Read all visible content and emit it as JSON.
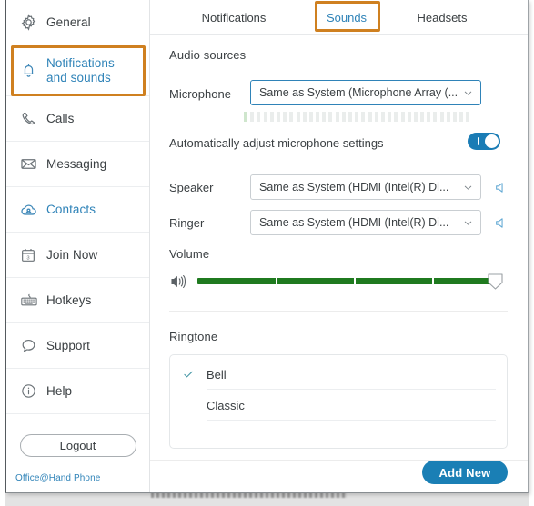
{
  "sidebar": {
    "items": [
      {
        "label": "General",
        "icon": "gear-icon",
        "accent": false
      },
      {
        "label": "Notifications and sounds",
        "label_line1": "Notifications",
        "label_line2": "and sounds",
        "icon": "bell-icon",
        "accent": true
      },
      {
        "label": "Calls",
        "icon": "phone-icon",
        "accent": false
      },
      {
        "label": "Messaging",
        "icon": "envelope-icon",
        "accent": false
      },
      {
        "label": "Contacts",
        "icon": "cloud-icon",
        "accent": true
      },
      {
        "label": "Join Now",
        "icon": "calendar-icon",
        "accent": false
      },
      {
        "label": "Hotkeys",
        "icon": "keyboard-icon",
        "accent": false
      },
      {
        "label": "Support",
        "icon": "chat-bubble-icon",
        "accent": false
      },
      {
        "label": "Help",
        "icon": "info-circle-icon",
        "accent": false
      }
    ],
    "logout_label": "Logout",
    "account_label": "Office@Hand Phone",
    "selected_item": "Notifications and sounds",
    "highlight_color": "#cf8020",
    "accent_color": "#2f83b8"
  },
  "tabs": {
    "items": [
      {
        "label": "Notifications",
        "active": false
      },
      {
        "label": "Sounds",
        "active": true
      },
      {
        "label": "Headsets",
        "active": false
      }
    ],
    "highlight_color": "#cf8020"
  },
  "main": {
    "audio_sources_title": "Audio sources",
    "microphone": {
      "label": "Microphone",
      "value": "Same as System (Microphone Array (...",
      "chevron": "chevron-down-icon",
      "meter_bars": 35,
      "meter_active_bars": 1
    },
    "auto_adjust": {
      "label": "Automatically adjust microphone settings",
      "enabled": true,
      "toggle_color": "#1a7cb5"
    },
    "speaker": {
      "label": "Speaker",
      "value": "Same as System (HDMI   (Intel(R) Di...",
      "chevron": "chevron-down-icon",
      "test_icon": "speaker-icon"
    },
    "ringer": {
      "label": "Ringer",
      "value": "Same as System (HDMI   (Intel(R) Di...",
      "chevron": "chevron-down-icon",
      "test_icon": "speaker-icon"
    },
    "volume": {
      "title": "Volume",
      "icon": "volume-up-icon",
      "level_percent": 100,
      "fill_color": "#1f7a1f",
      "tick_count": 4
    },
    "ringtone": {
      "title": "Ringtone",
      "selected": "Bell",
      "check_color": "#4a9aa8",
      "options": [
        {
          "name": "Bell",
          "selected": true
        },
        {
          "name": "Classic",
          "selected": false
        }
      ]
    },
    "add_new_label": "Add New",
    "add_new_color": "#1a7fb5"
  }
}
